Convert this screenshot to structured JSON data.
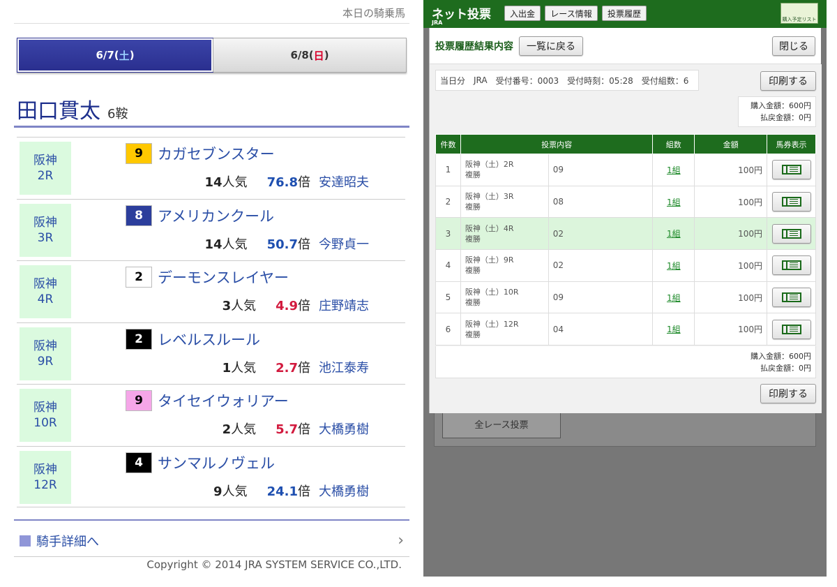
{
  "left": {
    "top_link": "本日の騎乗馬",
    "tabs": [
      {
        "date": "6/7(",
        "day": "土",
        "close": ")"
      },
      {
        "date": "6/8(",
        "day": "日",
        "close": ")"
      }
    ],
    "jockey_name": "田口貫太",
    "ride_count": "6鞍",
    "races": [
      {
        "venue": "阪神",
        "race": "2R",
        "waku": "9",
        "waku_bg": "#ffc800",
        "waku_fg": "#000000",
        "horse": "カガセブンスター",
        "pop": "14",
        "pop_suffix": "人気",
        "odds": "76.8",
        "odds_suffix": "倍",
        "odds_color": "blue",
        "trainer": "安達昭夫"
      },
      {
        "venue": "阪神",
        "race": "3R",
        "waku": "8",
        "waku_bg": "#2c3e9c",
        "waku_fg": "#ffffff",
        "horse": "アメリカンクール",
        "pop": "14",
        "pop_suffix": "人気",
        "odds": "50.7",
        "odds_suffix": "倍",
        "odds_color": "blue",
        "trainer": "今野貞一"
      },
      {
        "venue": "阪神",
        "race": "4R",
        "waku": "2",
        "waku_bg": "#ffffff",
        "waku_fg": "#000000",
        "horse": "デーモンスレイヤー",
        "pop": "3",
        "pop_suffix": "人気",
        "odds": "4.9",
        "odds_suffix": "倍",
        "odds_color": "red",
        "trainer": "庄野靖志"
      },
      {
        "venue": "阪神",
        "race": "9R",
        "waku": "2",
        "waku_bg": "#000000",
        "waku_fg": "#ffffff",
        "horse": "レベルスルール",
        "pop": "1",
        "pop_suffix": "人気",
        "odds": "2.7",
        "odds_suffix": "倍",
        "odds_color": "red",
        "trainer": "池江泰寿"
      },
      {
        "venue": "阪神",
        "race": "10R",
        "waku": "9",
        "waku_bg": "#f5a6e8",
        "waku_fg": "#000000",
        "horse": "タイセイウォリアー",
        "pop": "2",
        "pop_suffix": "人気",
        "odds": "5.7",
        "odds_suffix": "倍",
        "odds_color": "red",
        "trainer": "大橋勇樹"
      },
      {
        "venue": "阪神",
        "race": "12R",
        "waku": "4",
        "waku_bg": "#000000",
        "waku_fg": "#ffffff",
        "horse": "サンマルノヴェル",
        "pop": "9",
        "pop_suffix": "人気",
        "odds": "24.1",
        "odds_suffix": "倍",
        "odds_color": "blue",
        "trainer": "大橋勇樹"
      }
    ],
    "detail_link": "騎手詳細へ",
    "chevron": "›",
    "copyright": "Copyright © 2014 JRA SYSTEM SERVICE CO.,LTD."
  },
  "right": {
    "brand": "ネット投票",
    "brand_sub": "JRA",
    "nav_tabs": [
      "入出金",
      "レース情報",
      "投票履歴"
    ],
    "list_icon_label": "購入予定リスト",
    "bg_button": "全レース投票",
    "modal_title": "投票履歴結果内容",
    "back_button": "一覧に戻る",
    "close_button": "閉じる",
    "receipt": {
      "day": "当日分",
      "org": "JRA",
      "number": "受付番号：0003",
      "time": "受付時刻：05:28",
      "groups": "受付組数：6"
    },
    "print_button": "印刷する",
    "purchase_total": "購入金額：600円",
    "refund_total": "払戻金額：0円",
    "table_headers": [
      "件数",
      "投票内容",
      "組数",
      "金額",
      "馬券表示"
    ],
    "bets": [
      {
        "no": "1",
        "race": "阪神（土）2R",
        "type": "複勝",
        "content": "09",
        "groups": "1組",
        "amount": "100円"
      },
      {
        "no": "2",
        "race": "阪神（土）3R",
        "type": "複勝",
        "content": "08",
        "groups": "1組",
        "amount": "100円"
      },
      {
        "no": "3",
        "race": "阪神（土）4R",
        "type": "複勝",
        "content": "02",
        "groups": "1組",
        "amount": "100円"
      },
      {
        "no": "4",
        "race": "阪神（土）9R",
        "type": "複勝",
        "content": "02",
        "groups": "1組",
        "amount": "100円"
      },
      {
        "no": "5",
        "race": "阪神（土）10R",
        "type": "複勝",
        "content": "09",
        "groups": "1組",
        "amount": "100円"
      },
      {
        "no": "6",
        "race": "阪神（土）12R",
        "type": "複勝",
        "content": "04",
        "groups": "1組",
        "amount": "100円"
      }
    ]
  }
}
